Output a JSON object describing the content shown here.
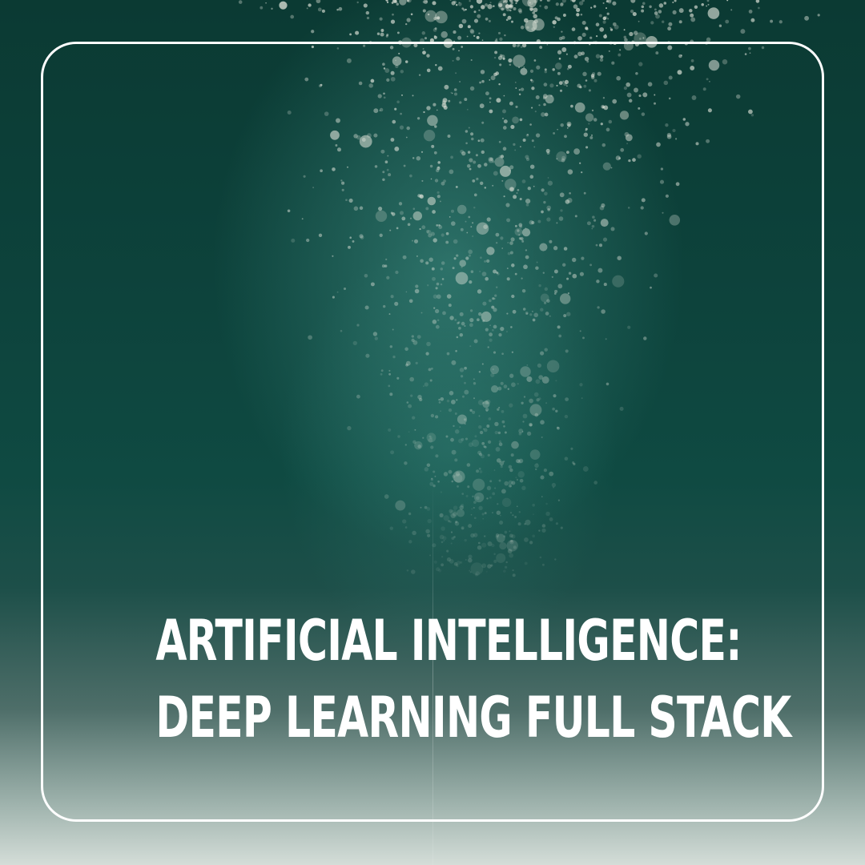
{
  "title": {
    "line1": "ARTIFICIAL INTELLIGENCE:",
    "line2": "DEEP LEARNING FULL STACK"
  },
  "colors": {
    "water_dark": "#0b3a33",
    "water_mid": "#0f4a42",
    "fade_bottom": "#d4ddd8",
    "frame": "#ffffff",
    "text": "#ffffff"
  },
  "background": {
    "description_icon": "underwater-bubbles-photo"
  }
}
